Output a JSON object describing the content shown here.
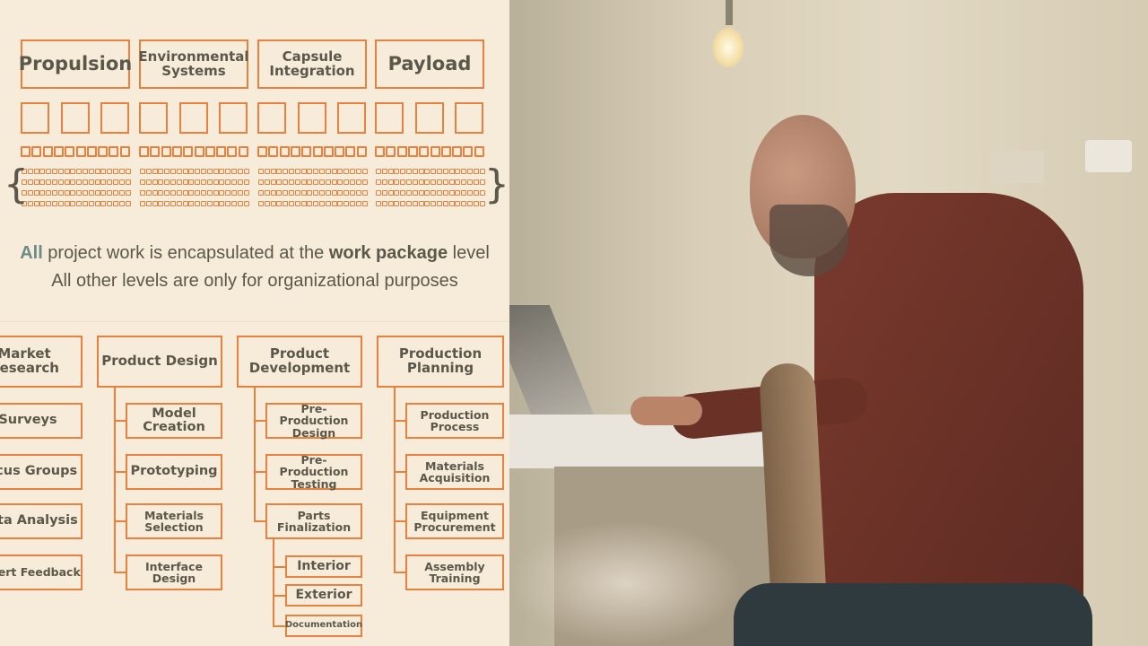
{
  "colors": {
    "accent": "#e8803f",
    "text": "#5b574a",
    "highlight": "#6b8b85",
    "background": "#f7ecd9",
    "shirt": "#6b3227"
  },
  "top_diagram": {
    "level1": [
      "Propulsion",
      "Environmental Systems",
      "Capsule Integration",
      "Payload"
    ]
  },
  "caption": {
    "line1_prefix": "All",
    "line1_mid": " project work is encapsulated at the ",
    "line1_bold": "work package",
    "line1_suffix": " level",
    "line2": "All other levels are only for organizational purposes"
  },
  "bottom_diagram": {
    "columns": [
      {
        "title": "Market Research",
        "children": [
          {
            "label": "Surveys"
          },
          {
            "label": "Focus Groups"
          },
          {
            "label": "Data Analysis"
          },
          {
            "label": "Expert Feedback"
          }
        ]
      },
      {
        "title": "Product Design",
        "children": [
          {
            "label": "Model Creation"
          },
          {
            "label": "Prototyping"
          },
          {
            "label": "Materials Selection"
          },
          {
            "label": "Interface Design"
          }
        ]
      },
      {
        "title": "Product Development",
        "children": [
          {
            "label": "Pre-Production Design"
          },
          {
            "label": "Pre-Production Testing"
          },
          {
            "label": "Parts Finalization",
            "children": [
              "Interior",
              "Exterior",
              "Documentation"
            ]
          }
        ]
      },
      {
        "title": "Production Planning",
        "children": [
          {
            "label": "Production Process"
          },
          {
            "label": "Materials Acquisition"
          },
          {
            "label": "Equipment Procurement"
          },
          {
            "label": "Assembly Training"
          }
        ]
      }
    ]
  },
  "photo": {
    "subject": "man typing on laptop at desk"
  }
}
